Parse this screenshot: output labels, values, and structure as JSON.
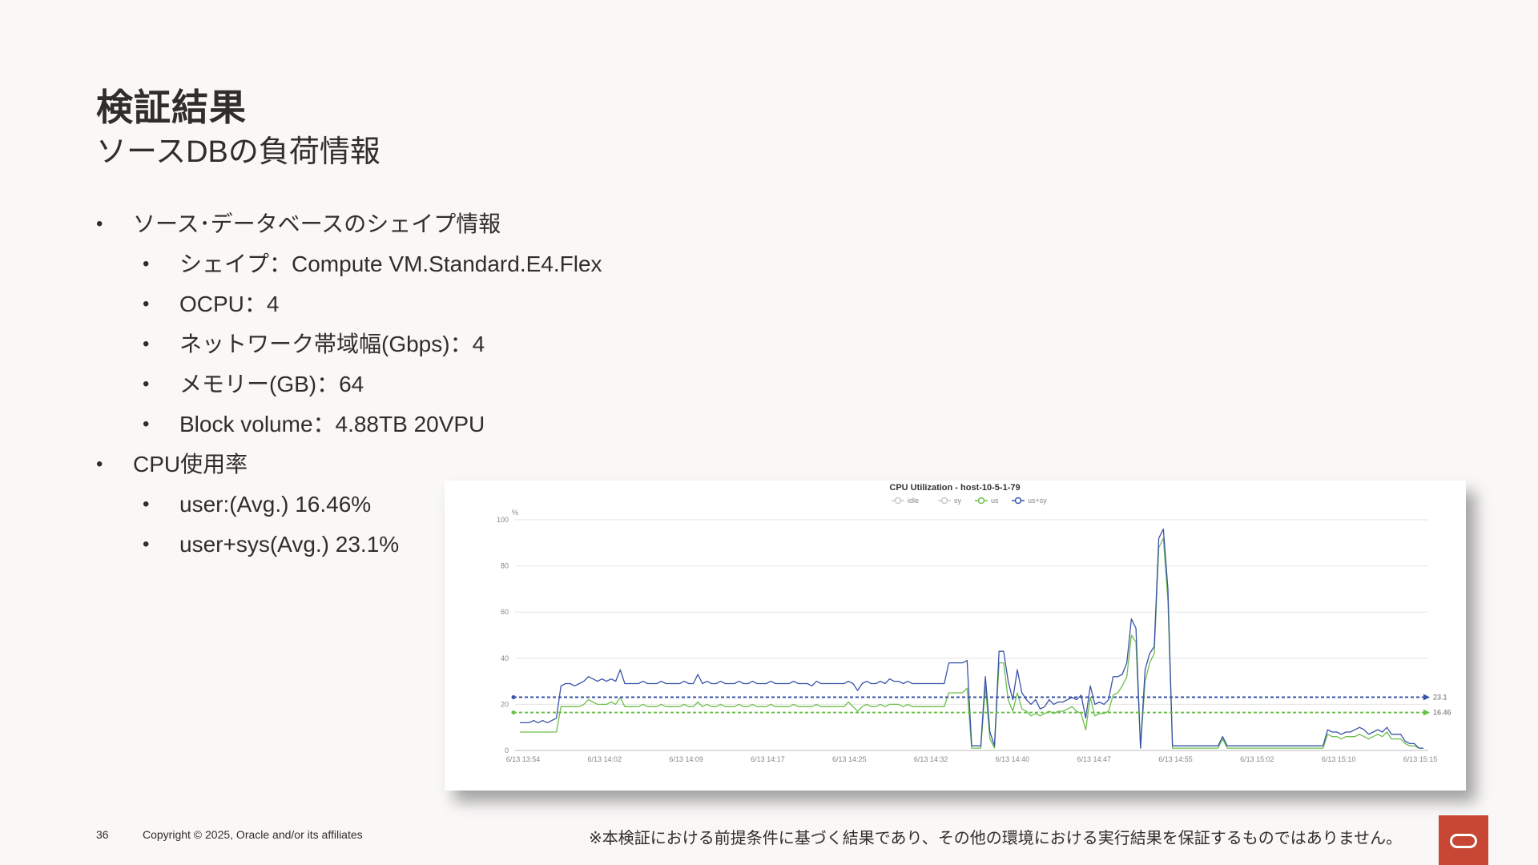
{
  "slide": {
    "title": "検証結果",
    "subtitle": "ソースDBの負荷情報",
    "bullets": [
      {
        "level": 1,
        "text": "ソース･データベースのシェイプ情報"
      },
      {
        "level": 2,
        "text": "シェイプ：Compute VM.Standard.E4.Flex"
      },
      {
        "level": 2,
        "text": "OCPU：4"
      },
      {
        "level": 2,
        "text": "ネットワーク帯域幅(Gbps)：4"
      },
      {
        "level": 2,
        "text": "メモリー(GB)：64"
      },
      {
        "level": 2,
        "text": "Block volume：4.88TB 20VPU"
      },
      {
        "level": 1,
        "text": "CPU使用率"
      },
      {
        "level": 2,
        "text": "user:(Avg.) 16.46%"
      },
      {
        "level": 2,
        "text": "user+sys(Avg.) 23.1%"
      }
    ],
    "page_number": "36",
    "copyright": "Copyright © 2025, Oracle and/or its affiliates",
    "disclaimer": "※本検証における前提条件に基づく結果であり、その他の環境における実行結果を保証するものではありません。",
    "logo_color": "#c74634"
  },
  "chart_data": {
    "type": "line",
    "title": "CPU Utilization - host-10-5-1-79",
    "ylabel": "%",
    "ylim": [
      0,
      100
    ],
    "yticks": [
      0,
      20,
      40,
      60,
      80,
      100
    ],
    "x_tick_labels": [
      "6/13 13:54",
      "6/13 14:02",
      "6/13 14:09",
      "6/13 14:17",
      "6/13 14:25",
      "6/13 14:32",
      "6/13 14:40",
      "6/13 14:47",
      "6/13 14:55",
      "6/13 15:02",
      "6/13 15:10",
      "6/13 15:15"
    ],
    "legend_position": "top",
    "legend": [
      {
        "name": "idle",
        "color": "#c8c8c8"
      },
      {
        "name": "sy",
        "color": "#c8c8c8"
      },
      {
        "name": "us",
        "color": "#6cbf4a"
      },
      {
        "name": "us+sy",
        "color": "#3a52a8"
      }
    ],
    "reference_lines": [
      {
        "value": 23.1,
        "label": "23.1",
        "color": "#3a52a8"
      },
      {
        "value": 16.46,
        "label": "16.46",
        "color": "#6cbf4a"
      }
    ],
    "series": [
      {
        "name": "us+sy",
        "color": "#3a52a8",
        "values": [
          12,
          12,
          12,
          13,
          12,
          13,
          12,
          13,
          14,
          28,
          29,
          29,
          28,
          29,
          30,
          32,
          31,
          30,
          31,
          30,
          31,
          30,
          35,
          29,
          29,
          29,
          29,
          30,
          29,
          29,
          29,
          30,
          29,
          29,
          29,
          29,
          30,
          29,
          29,
          33,
          29,
          30,
          29,
          29,
          30,
          29,
          29,
          29,
          30,
          29,
          29,
          30,
          29,
          29,
          29,
          30,
          29,
          29,
          29,
          29,
          30,
          29,
          29,
          29,
          28,
          30,
          29,
          29,
          29,
          29,
          29,
          29,
          30,
          29,
          26,
          29,
          30,
          29,
          29,
          30,
          29,
          31,
          30,
          30,
          29,
          30,
          29,
          29,
          29,
          29,
          29,
          29,
          29,
          29,
          38,
          38,
          38,
          38,
          39,
          2,
          2,
          2,
          32,
          8,
          2,
          43,
          43,
          30,
          22,
          35,
          25,
          22,
          20,
          22,
          18,
          19,
          22,
          20,
          21,
          21,
          22,
          23,
          22,
          24,
          14,
          28,
          20,
          21,
          20,
          22,
          32,
          32,
          33,
          38,
          57,
          53,
          1,
          35,
          42,
          45,
          92,
          96,
          70,
          2,
          2,
          2,
          2,
          2,
          2,
          2,
          2,
          2,
          2,
          2,
          6,
          2,
          2,
          2,
          2,
          2,
          2,
          2,
          2,
          2,
          2,
          2,
          2,
          2,
          2,
          2,
          2,
          2,
          2,
          2,
          2,
          2,
          2,
          9,
          8,
          8,
          7,
          8,
          8,
          9,
          10,
          9,
          7,
          8,
          9,
          8,
          10,
          7,
          7,
          7,
          4,
          3,
          3,
          1,
          1
        ]
      },
      {
        "name": "us",
        "color": "#6cbf4a",
        "values": [
          8,
          8,
          8,
          8,
          8,
          8,
          8,
          8,
          8,
          19,
          19,
          19,
          19,
          19,
          20,
          22,
          21,
          20,
          20,
          20,
          21,
          20,
          23,
          19,
          19,
          19,
          19,
          20,
          19,
          19,
          19,
          20,
          19,
          19,
          19,
          19,
          20,
          19,
          19,
          21,
          19,
          20,
          19,
          19,
          20,
          19,
          19,
          19,
          20,
          19,
          19,
          20,
          19,
          19,
          19,
          20,
          19,
          19,
          19,
          19,
          20,
          19,
          19,
          19,
          19,
          20,
          19,
          19,
          19,
          19,
          19,
          19,
          21,
          19,
          17,
          19,
          20,
          19,
          19,
          20,
          19,
          20,
          20,
          20,
          19,
          20,
          19,
          19,
          19,
          19,
          19,
          19,
          19,
          19,
          25,
          25,
          25,
          25,
          27,
          1,
          1,
          1,
          28,
          5,
          1,
          38,
          38,
          22,
          17,
          25,
          18,
          17,
          15,
          16,
          15,
          16,
          17,
          16,
          17,
          17,
          18,
          19,
          17,
          16,
          9,
          23,
          15,
          16,
          16,
          17,
          24,
          25,
          28,
          32,
          50,
          47,
          1,
          30,
          38,
          42,
          88,
          92,
          65,
          1,
          1,
          1,
          1,
          1,
          1,
          1,
          1,
          1,
          1,
          1,
          5,
          1,
          1,
          1,
          1,
          1,
          1,
          1,
          1,
          1,
          1,
          1,
          1,
          1,
          1,
          1,
          1,
          1,
          1,
          1,
          1,
          1,
          1,
          7,
          6,
          6,
          5,
          6,
          6,
          6,
          7,
          6,
          5,
          6,
          7,
          6,
          8,
          5,
          5,
          5,
          3,
          2,
          2,
          1,
          1
        ]
      }
    ]
  }
}
